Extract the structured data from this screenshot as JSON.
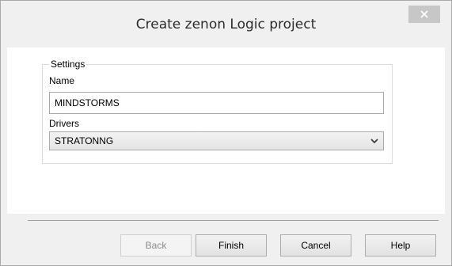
{
  "window": {
    "title": "Create zenon Logic project"
  },
  "settings": {
    "group_label": "Settings",
    "name_label": "Name",
    "name_value": "MINDSTORMS",
    "drivers_label": "Drivers",
    "drivers_selected": "STRATONNG"
  },
  "buttons": {
    "back": "Back",
    "finish": "Finish",
    "cancel": "Cancel",
    "help": "Help"
  },
  "icons": {
    "close": "close-icon",
    "dropdown": "chevron-down-icon"
  }
}
